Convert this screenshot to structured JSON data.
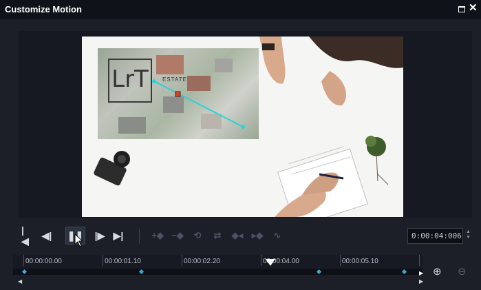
{
  "window": {
    "title": "Customize Motion"
  },
  "preview": {
    "logo_text": "LrT",
    "overlay_text": "ESTATE"
  },
  "controls": {
    "timecode": "0:00:04:006",
    "playback_icons": [
      "go-to-start-icon",
      "previous-frame-icon",
      "pause-icon",
      "next-frame-icon",
      "go-to-end-icon"
    ],
    "keyframe_icons": [
      "add-keyframe-icon",
      "remove-keyframe-icon",
      "reverse-path-icon",
      "swap-icon",
      "previous-keyframe-icon",
      "next-keyframe-icon",
      "smooth-path-icon"
    ]
  },
  "timeline": {
    "ticks": [
      "00:00:00.00",
      "00:00:01.10",
      "00:00:02.20",
      "00:00:04.00",
      "00:00:05.10"
    ],
    "keyframe_color": "#3aa8d8"
  },
  "colors": {
    "path": "#29d3d9",
    "accent": "#3aa8d8"
  }
}
